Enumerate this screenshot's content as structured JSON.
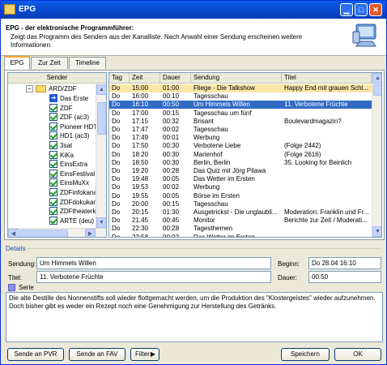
{
  "window": {
    "title": "EPG"
  },
  "header": {
    "title": "EPG - der elektronische Programmführer:",
    "description": "Zeigt das Programm des Senders aus der Kanalliste. Nach Anwahl einer Sendung erscheinen weitere Informationen."
  },
  "tabs": [
    "EPG",
    "Zur Zeit",
    "Timeline"
  ],
  "tree": {
    "header": "Sender",
    "group": "ARD/ZDF",
    "channels": [
      "Das Erste",
      "ZDF",
      "ZDF (ac3)",
      "Pioneer HDT",
      "HD1 (ac3)",
      "3sat",
      "KiKa",
      "EinsExtra",
      "EinsFestival",
      "EinsMuXx",
      "ZDFinfokanal",
      "ZDFdokukanal",
      "ZDFtheaterk",
      "ARTE (deu)"
    ]
  },
  "grid": {
    "columns": [
      "Tag",
      "Zeit",
      "Dauer",
      "Sendung",
      "Titel"
    ],
    "rows": [
      [
        "Do",
        "15:00",
        "01:00",
        "Fliege - Die Talkshow",
        "Happy End mit grauen Schl..."
      ],
      [
        "Do",
        "16:00",
        "00:10",
        "Tagesschau",
        ""
      ],
      [
        "Do",
        "16:10",
        "00:50",
        "Um Himmels Willen",
        "11. Verbotene Früchte"
      ],
      [
        "Do",
        "17:00",
        "00:15",
        "Tagesschau um fünf",
        ""
      ],
      [
        "Do",
        "17:15",
        "00:32",
        "Brisant",
        "Boulevardmagazin?"
      ],
      [
        "Do",
        "17:47",
        "00:02",
        "Tagesschau",
        ""
      ],
      [
        "Do",
        "17:49",
        "00:01",
        "Werbung",
        ""
      ],
      [
        "Do",
        "17:50",
        "00:30",
        "Verbotene Liebe",
        "(Folge 2442)"
      ],
      [
        "Do",
        "18:20",
        "00:30",
        "Marienhof",
        "(Folge 2616)"
      ],
      [
        "Do",
        "18:50",
        "00:30",
        "Berlin, Berlin",
        "35. Looking for Beinlich"
      ],
      [
        "Do",
        "19:20",
        "00:28",
        "Das Quiz mit Jörg Pilawa",
        ""
      ],
      [
        "Do",
        "19:48",
        "00:05",
        "Das Wetter im Ersten",
        ""
      ],
      [
        "Do",
        "19:53",
        "00:02",
        "Werbung",
        ""
      ],
      [
        "Do",
        "19:55",
        "00:05",
        "Börse im Ersten",
        ""
      ],
      [
        "Do",
        "20:00",
        "00:15",
        "Tagesschau",
        ""
      ],
      [
        "Do",
        "20:15",
        "01:30",
        "Ausgetrickst - Die unglaubli...",
        "Moderation: Franklin und Fr..."
      ],
      [
        "Do",
        "21:45",
        "00:45",
        "Monitor",
        "Berichte zur Zeit / Moderati..."
      ],
      [
        "Do",
        "22:30",
        "00:28",
        "Tagesthemen",
        ""
      ],
      [
        "Do",
        "22:58",
        "00:02",
        "Das Wetter im Ersten",
        ""
      ]
    ]
  },
  "details": {
    "label": "Details",
    "sendung_label": "Sendung:",
    "sendung_value": "Um Himmels Willen",
    "beginn_label": "Beginn:",
    "beginn_value": "Do 28.04   16:10",
    "titel_label": "Titel:",
    "titel_value": "11. Verbotene Früchte",
    "dauer_label": "Dauer:",
    "dauer_value": "00:50",
    "serie_label": "Serie",
    "description": "Die alte Destille des Nonnenstifts soll wieder flottgemacht werden, um die Produktion des \"Klostergeistes\" wieder aufzunehmen. Doch bisher gibt es weder ein Rezept noch eine Genehmigung zur Herstellung des Getränks."
  },
  "buttons": {
    "send_pvr": "Sende an PVR",
    "send_fav": "Sende an FAV",
    "filter": "Filter",
    "save": "Speichern",
    "ok": "OK"
  }
}
